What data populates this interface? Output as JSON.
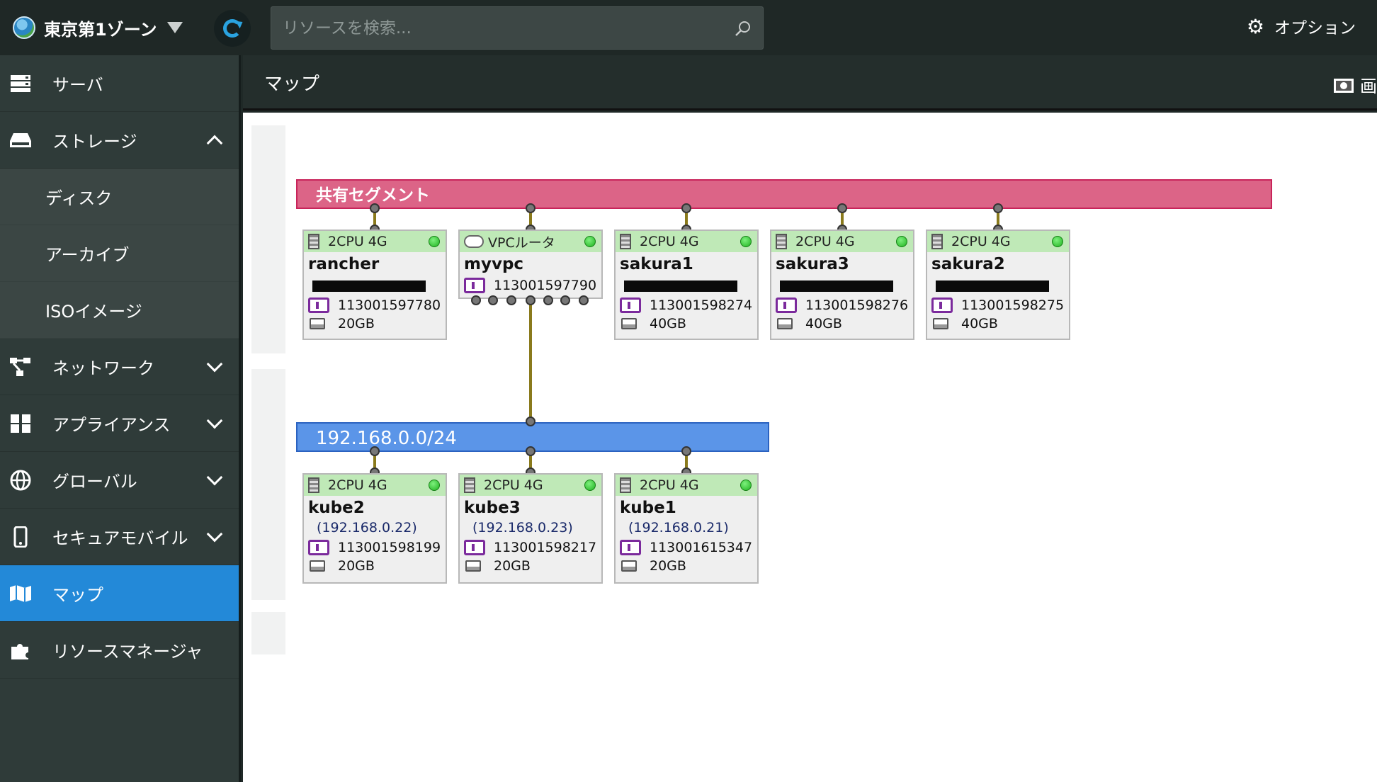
{
  "topbar": {
    "zone": "東京第1ゾーン",
    "search_placeholder": "リソースを検索...",
    "options": "オプション"
  },
  "sidebar": {
    "items": [
      {
        "label": "サーバ",
        "icon": "server-icon",
        "expanded": null
      },
      {
        "label": "ストレージ",
        "icon": "storage-icon",
        "expanded": true,
        "children": [
          "ディスク",
          "アーカイブ",
          "ISOイメージ"
        ]
      },
      {
        "label": "ネットワーク",
        "icon": "network-icon",
        "expanded": false
      },
      {
        "label": "アプライアンス",
        "icon": "appliance-icon",
        "expanded": false
      },
      {
        "label": "グローバル",
        "icon": "globe-icon",
        "expanded": false
      },
      {
        "label": "セキュアモバイル",
        "icon": "mobile-icon",
        "expanded": false
      },
      {
        "label": "マップ",
        "icon": "map-icon",
        "active": true
      },
      {
        "label": "リソースマネージャ",
        "icon": "puzzle-icon",
        "expanded": null
      }
    ]
  },
  "content": {
    "title": "マップ",
    "header_tool_label": "画"
  },
  "map": {
    "shared_segment": "共有セグメント",
    "lan_segment": "192.168.0.0/24",
    "upper_nodes": [
      {
        "spec": "2CPU 4G",
        "name": "rancher",
        "id": "113001597780",
        "disk": "20GB",
        "type": "server",
        "status": "green"
      },
      {
        "spec": "VPCルータ",
        "name": "myvpc",
        "id": "113001597790",
        "type": "router",
        "status": "green"
      },
      {
        "spec": "2CPU 4G",
        "name": "sakura1",
        "id": "113001598274",
        "disk": "40GB",
        "type": "server",
        "status": "green"
      },
      {
        "spec": "2CPU 4G",
        "name": "sakura3",
        "id": "113001598276",
        "disk": "40GB",
        "type": "server",
        "status": "green"
      },
      {
        "spec": "2CPU 4G",
        "name": "sakura2",
        "id": "113001598275",
        "disk": "40GB",
        "type": "server",
        "status": "green"
      }
    ],
    "lower_nodes": [
      {
        "spec": "2CPU 4G",
        "name": "kube2",
        "ip": "(192.168.0.22)",
        "id": "113001598199",
        "disk": "20GB",
        "status": "green"
      },
      {
        "spec": "2CPU 4G",
        "name": "kube3",
        "ip": "(192.168.0.23)",
        "id": "113001598217",
        "disk": "20GB",
        "status": "green"
      },
      {
        "spec": "2CPU 4G",
        "name": "kube1",
        "ip": "(192.168.0.21)",
        "id": "113001615347",
        "disk": "20GB",
        "status": "green"
      }
    ]
  },
  "colors": {
    "sidebar_active": "#2389d8",
    "shared_segment": "#dc6487",
    "lan_segment": "#5b95e8",
    "status_ok": "#1fb21f",
    "node_header": "#bfe9b7"
  }
}
